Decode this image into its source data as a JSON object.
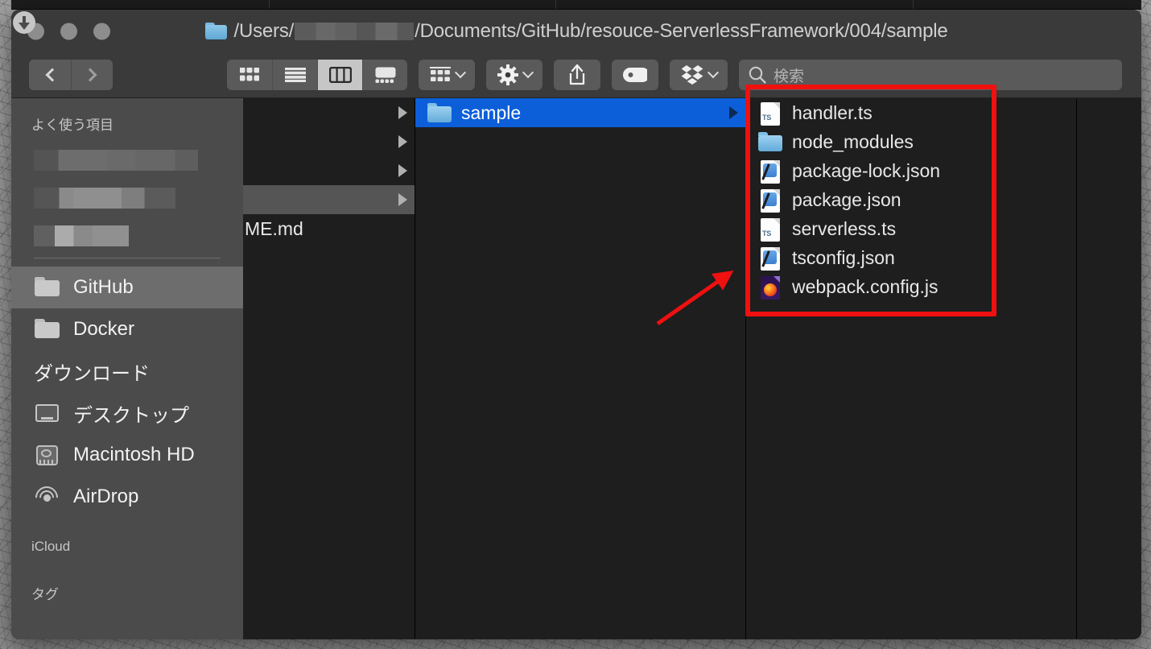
{
  "window": {
    "title_prefix": "/Users/",
    "title_suffix": "/Documents/GitHub/resouce-ServerlessFramework/004/sample",
    "title_redacted": true,
    "folder_icon": "folder-icon"
  },
  "traffic_lights": [
    {
      "name": "close-button",
      "color": "#8d8d8d"
    },
    {
      "name": "minimize-button",
      "color": "#8d8d8d"
    },
    {
      "name": "zoom-button",
      "color": "#8d8d8d"
    }
  ],
  "toolbar": {
    "back_label": "‹",
    "forward_label": "›",
    "view_modes": [
      {
        "name": "icon-view",
        "label": "icon",
        "active": false
      },
      {
        "name": "list-view",
        "label": "list",
        "active": false
      },
      {
        "name": "column-view",
        "label": "column",
        "active": true
      },
      {
        "name": "gallery-view",
        "label": "gallery",
        "active": false
      }
    ],
    "group_by_label": "group-by",
    "action_label": "action-gear",
    "share_label": "share",
    "tag_label": "tag",
    "dropbox_label": "dropbox",
    "search_placeholder": "検索",
    "search_value": ""
  },
  "sidebar": {
    "sections": [
      {
        "header": "よく使う項目",
        "redacted_rows": 3,
        "items": [
          {
            "label": "GitHub",
            "icon": "folder-icon",
            "selected": true
          },
          {
            "label": "Docker",
            "icon": "folder-icon",
            "selected": false
          },
          {
            "label": "ダウンロード",
            "icon": "downloads-icon",
            "selected": false
          },
          {
            "label": "デスクトップ",
            "icon": "desktop-icon",
            "selected": false
          },
          {
            "label": "Macintosh HD",
            "icon": "harddisk-icon",
            "selected": false
          },
          {
            "label": "AirDrop",
            "icon": "airdrop-icon",
            "selected": false
          }
        ]
      },
      {
        "header": "iCloud",
        "redacted_rows": 0,
        "items": []
      },
      {
        "header": "タグ",
        "redacted_rows": 0,
        "items": []
      }
    ]
  },
  "columns": [
    {
      "name": "column-1",
      "rows": [
        {
          "label": "",
          "icon": "none",
          "state": "none",
          "has_disclosure": true
        },
        {
          "label": "",
          "icon": "none",
          "state": "none",
          "has_disclosure": true
        },
        {
          "label": "",
          "icon": "none",
          "state": "none",
          "has_disclosure": true
        },
        {
          "label": "",
          "icon": "none",
          "state": "gray",
          "has_disclosure": true
        },
        {
          "label": "ME.md",
          "icon": "none",
          "state": "none",
          "has_disclosure": false
        }
      ]
    },
    {
      "name": "column-2",
      "rows": [
        {
          "label": "sample",
          "icon": "folder-icon",
          "state": "blue",
          "has_disclosure": true
        }
      ]
    },
    {
      "name": "column-3",
      "rows": [
        {
          "label": "handler.ts",
          "icon": "ts-file-icon",
          "state": "none",
          "has_disclosure": false
        },
        {
          "label": "node_modules",
          "icon": "folder-icon",
          "state": "none",
          "has_disclosure": true
        },
        {
          "label": "package-lock.json",
          "icon": "json-file-icon",
          "state": "none",
          "has_disclosure": false
        },
        {
          "label": "package.json",
          "icon": "json-file-icon",
          "state": "none",
          "has_disclosure": false
        },
        {
          "label": "serverless.ts",
          "icon": "ts-file-icon",
          "state": "none",
          "has_disclosure": false
        },
        {
          "label": "tsconfig.json",
          "icon": "json-file-icon",
          "state": "none",
          "has_disclosure": false
        },
        {
          "label": "webpack.config.js",
          "icon": "firefox-file-icon",
          "state": "none",
          "has_disclosure": false
        }
      ]
    },
    {
      "name": "column-4",
      "rows": []
    },
    {
      "name": "column-5",
      "rows": []
    }
  ],
  "annotations": {
    "highlight_box_color": "#ef1010",
    "arrow_color": "#ef1010",
    "arrow_target": "file-list-highlight"
  },
  "ts_badge_text": "TS"
}
